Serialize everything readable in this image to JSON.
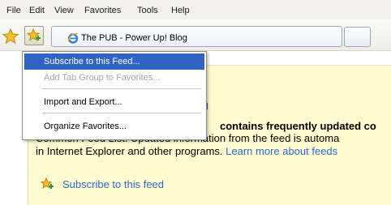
{
  "menubar": {
    "items": [
      "File",
      "Edit",
      "View",
      "Favorites",
      "Tools",
      "Help"
    ]
  },
  "tab": {
    "title": "The PUB - Power Up! Blog"
  },
  "feed_page": {
    "heading_fragment": "og",
    "bold_fragment": "contains frequently updated co",
    "line2": "Common Feed List. Updated information from the feed is automa",
    "line3_text": "in Internet Explorer and other programs. ",
    "line3_link": "Learn more about feeds",
    "subscribe_link": "Subscribe to this feed"
  },
  "favorites_menu": {
    "items": [
      {
        "label": "Subscribe to this Feed...",
        "state": "selected"
      },
      {
        "label": "Add Tab Group to Favorites...",
        "state": "disabled"
      },
      {
        "label": "Import and Export...",
        "state": "normal"
      },
      {
        "label": "Organize Favorites...",
        "state": "normal"
      }
    ]
  },
  "icons": {
    "favorites_center": "star-icon",
    "add_to_favorites": "star-plus-icon",
    "tab_favicon": "internet-explorer-icon",
    "feed_subscribe": "star-plus-icon"
  },
  "colors": {
    "menu_highlight": "#3163c5",
    "link": "#2e6ad1",
    "feed_background": "#fffbd0"
  }
}
